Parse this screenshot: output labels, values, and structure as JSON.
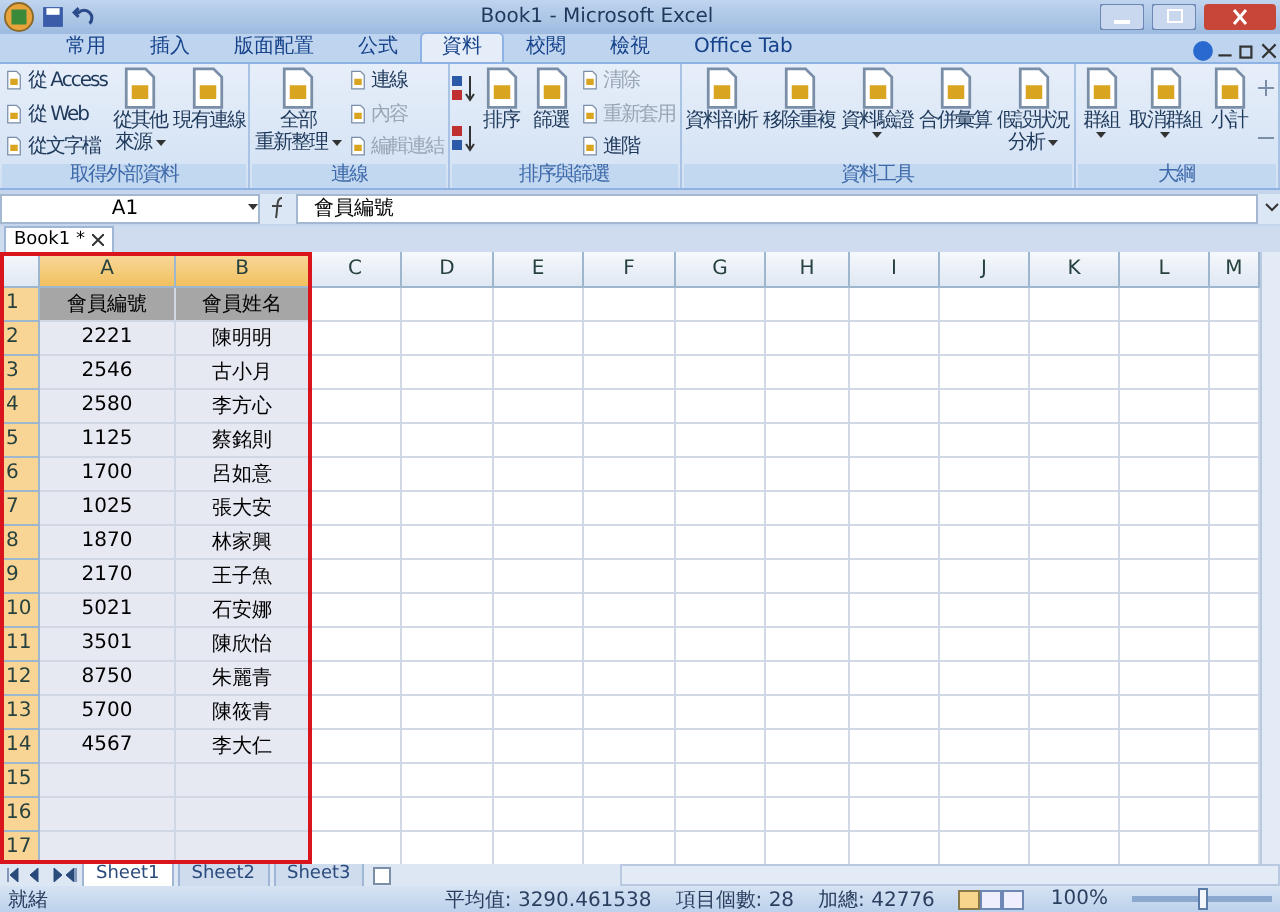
{
  "window": {
    "title": "Book1 - Microsoft Excel"
  },
  "ribbon_tabs": [
    {
      "label": "常用",
      "selected": false
    },
    {
      "label": "插入",
      "selected": false
    },
    {
      "label": "版面配置",
      "selected": false
    },
    {
      "label": "公式",
      "selected": false
    },
    {
      "label": "資料",
      "selected": true
    },
    {
      "label": "校閱",
      "selected": false
    },
    {
      "label": "檢視",
      "selected": false
    },
    {
      "label": "Office Tab",
      "selected": false
    }
  ],
  "ribbon_groups": [
    {
      "label": "取得外部資料",
      "columns": [
        {
          "kind": "stack",
          "items": [
            {
              "label": "從 Access",
              "disabled": false
            },
            {
              "label": "從 Web",
              "disabled": false
            },
            {
              "label": "從文字檔",
              "disabled": false
            }
          ]
        },
        {
          "kind": "large",
          "lines": [
            "從其他",
            "來源"
          ],
          "dropdown": true
        },
        {
          "kind": "large",
          "lines": [
            "現有連線"
          ],
          "dropdown": false
        }
      ]
    },
    {
      "label": "連線",
      "columns": [
        {
          "kind": "large",
          "lines": [
            "全部",
            "重新整理"
          ],
          "dropdown": true
        },
        {
          "kind": "stack",
          "items": [
            {
              "label": "連線",
              "disabled": false
            },
            {
              "label": "內容",
              "disabled": true
            },
            {
              "label": "編輯連結",
              "disabled": true
            }
          ]
        }
      ]
    },
    {
      "label": "排序與篩選",
      "columns": [
        {
          "kind": "sort"
        },
        {
          "kind": "large",
          "lines": [
            "排序"
          ],
          "dropdown": false
        },
        {
          "kind": "large",
          "lines": [
            "篩選"
          ],
          "dropdown": false
        },
        {
          "kind": "stack",
          "items": [
            {
              "label": "清除",
              "disabled": true
            },
            {
              "label": "重新套用",
              "disabled": true
            },
            {
              "label": "進階",
              "disabled": false
            }
          ]
        }
      ]
    },
    {
      "label": "資料工具",
      "columns": [
        {
          "kind": "large",
          "lines": [
            "資料剖析"
          ],
          "dropdown": false
        },
        {
          "kind": "large",
          "lines": [
            "移除重複"
          ],
          "dropdown": false
        },
        {
          "kind": "large",
          "lines": [
            "資料驗證"
          ],
          "dropdown": true
        },
        {
          "kind": "large",
          "lines": [
            "合併彙算"
          ],
          "dropdown": false
        },
        {
          "kind": "large",
          "lines": [
            "假設狀況",
            "分析"
          ],
          "dropdown": true
        }
      ]
    },
    {
      "label": "大綱",
      "columns": [
        {
          "kind": "large",
          "lines": [
            "群組"
          ],
          "dropdown": true
        },
        {
          "kind": "large",
          "lines": [
            "取消群組"
          ],
          "dropdown": true
        },
        {
          "kind": "large",
          "lines": [
            "小計"
          ],
          "dropdown": false
        },
        {
          "kind": "outline"
        }
      ]
    }
  ],
  "formula_bar": {
    "name_box": "A1",
    "formula": "會員編號"
  },
  "doc_tabs": [
    {
      "label": "Book1 *",
      "selected": true
    }
  ],
  "sheet": {
    "columns": [
      {
        "label": "A",
        "selected": true
      },
      {
        "label": "B",
        "selected": true
      },
      {
        "label": "C",
        "selected": false
      },
      {
        "label": "D",
        "selected": false
      },
      {
        "label": "E",
        "selected": false
      },
      {
        "label": "F",
        "selected": false
      },
      {
        "label": "G",
        "selected": false
      },
      {
        "label": "H",
        "selected": false
      },
      {
        "label": "I",
        "selected": false
      },
      {
        "label": "J",
        "selected": false
      },
      {
        "label": "K",
        "selected": false
      },
      {
        "label": "L",
        "selected": false
      },
      {
        "label": "M",
        "selected": false
      }
    ],
    "rows": [
      {
        "number": "1",
        "selected": true,
        "kind": "header",
        "cells": [
          "會員編號",
          "會員姓名"
        ]
      },
      {
        "number": "2",
        "selected": true,
        "kind": "data",
        "cells": [
          "2221",
          "陳明明"
        ]
      },
      {
        "number": "3",
        "selected": true,
        "kind": "data",
        "cells": [
          "2546",
          "古小月"
        ]
      },
      {
        "number": "4",
        "selected": true,
        "kind": "data",
        "cells": [
          "2580",
          "李方心"
        ]
      },
      {
        "number": "5",
        "selected": true,
        "kind": "data",
        "cells": [
          "1125",
          "蔡銘則"
        ]
      },
      {
        "number": "6",
        "selected": true,
        "kind": "data",
        "cells": [
          "1700",
          "呂如意"
        ]
      },
      {
        "number": "7",
        "selected": true,
        "kind": "data",
        "cells": [
          "1025",
          "張大安"
        ]
      },
      {
        "number": "8",
        "selected": true,
        "kind": "data",
        "cells": [
          "1870",
          "林家興"
        ]
      },
      {
        "number": "9",
        "selected": true,
        "kind": "data",
        "cells": [
          "2170",
          "王子魚"
        ]
      },
      {
        "number": "10",
        "selected": true,
        "kind": "data",
        "cells": [
          "5021",
          "石安娜"
        ]
      },
      {
        "number": "11",
        "selected": true,
        "kind": "data",
        "cells": [
          "3501",
          "陳欣怡"
        ]
      },
      {
        "number": "12",
        "selected": true,
        "kind": "data",
        "cells": [
          "8750",
          "朱麗青"
        ]
      },
      {
        "number": "13",
        "selected": true,
        "kind": "data",
        "cells": [
          "5700",
          "陳筱青"
        ]
      },
      {
        "number": "14",
        "selected": true,
        "kind": "data",
        "cells": [
          "4567",
          "李大仁"
        ]
      },
      {
        "number": "15",
        "selected": true,
        "kind": "empty"
      },
      {
        "number": "16",
        "selected": true,
        "kind": "empty"
      },
      {
        "number": "17",
        "selected": true,
        "kind": "empty"
      }
    ]
  },
  "sheet_tabs": [
    {
      "label": "Sheet1",
      "selected": true
    },
    {
      "label": "Sheet2",
      "selected": false
    },
    {
      "label": "Sheet3",
      "selected": false
    }
  ],
  "status_bar": {
    "mode": "就緒",
    "average": "平均值: 3290.461538",
    "count": "項目個數: 28",
    "sum": "加總: 42776",
    "zoom": "100%",
    "zoom_slider": {
      "level": 0.5
    }
  }
}
